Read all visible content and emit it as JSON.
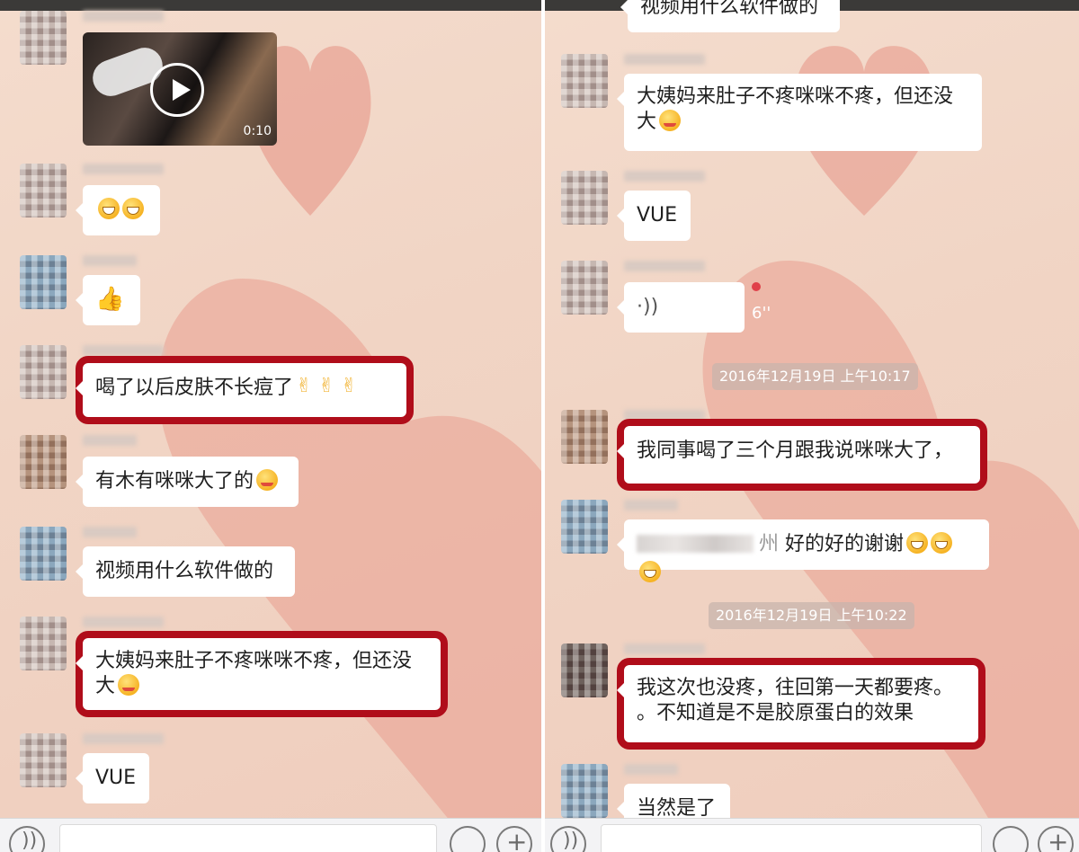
{
  "left": {
    "video": {
      "duration": "0:10"
    },
    "messages": {
      "m1": "",
      "m2": "",
      "m3": "喝了以后皮肤不长痘了",
      "m4": "有木有咪咪大了的",
      "m5": "视频用什么软件做的",
      "m6_line1": "大姨妈来肚子不疼咪咪不疼，但还没",
      "m6_line2": "大",
      "m7": "VUE"
    },
    "names": {
      "n1": "杨 苏州",
      "n4": "杨 苏州",
      "n7": "杨 苏州"
    }
  },
  "right": {
    "top_partial": "视频用什么软件做的",
    "messages": {
      "r1_line1": "大姨妈来肚子不疼咪咪不疼，但还没",
      "r1_line2": "大",
      "r2": "VUE",
      "r3_len": "6''",
      "r4": "我同事喝了三个月跟我说咪咪大了，",
      "r5_mention_suffix": "州",
      "r5": "好的好的谢谢",
      "r6_line1": "我这次也没疼，往回第一天都要疼。",
      "r6_line2": "。不知道是不是胶原蛋白的效果",
      "r7": "当然是了"
    },
    "names": {
      "n1": "杨 苏州",
      "n3": "杨",
      "n5": "青",
      "n6": "P",
      "n7": "青 山东"
    },
    "timestamps": {
      "t1": "2016年12月19日 上午10:17",
      "t2": "2016年12月19日 上午10:22"
    }
  }
}
